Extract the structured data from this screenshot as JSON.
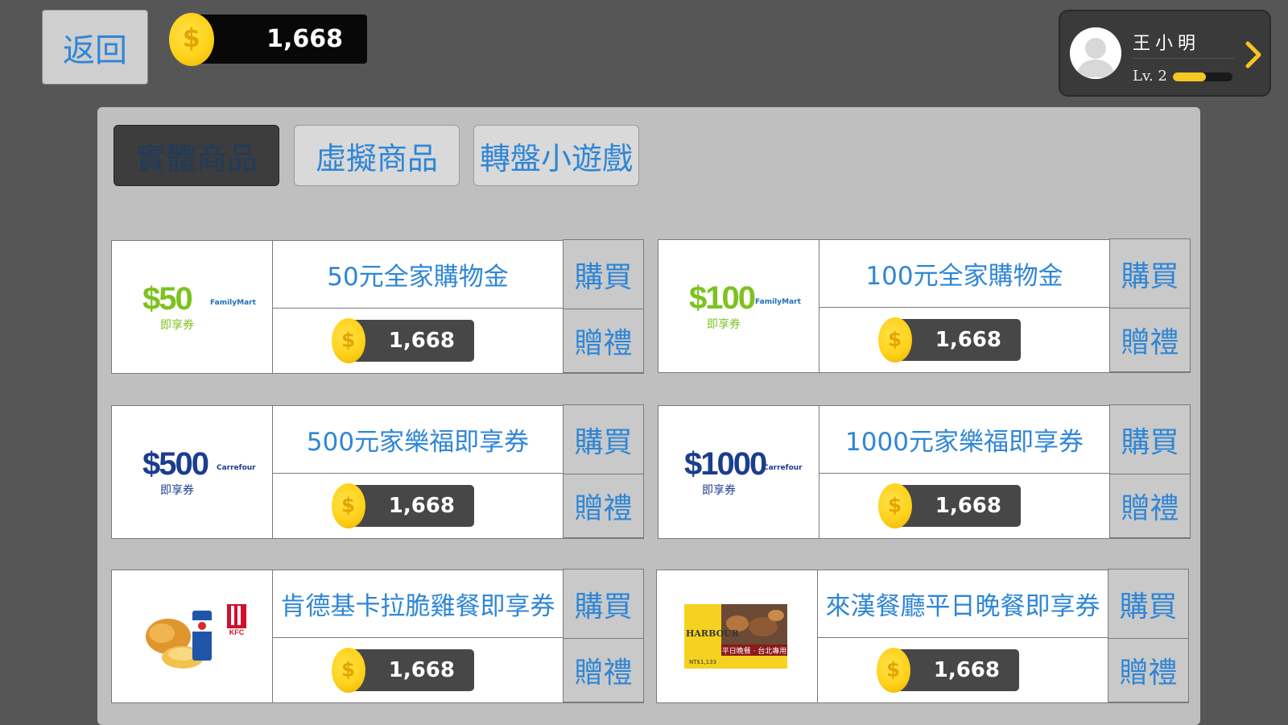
{
  "header": {
    "back_label": "返回",
    "coin_balance": "1,668"
  },
  "profile": {
    "name": "王小明",
    "level": "Lv. 2",
    "xp_progress": 0.55
  },
  "tabs": [
    {
      "label": "實體商品",
      "active": true
    },
    {
      "label": "虛擬商品",
      "active": false
    },
    {
      "label": "轉盤小遊戲",
      "active": false
    }
  ],
  "products": [
    {
      "title": "50元全家購物金",
      "price": "1,668",
      "buy": "購買",
      "gift": "贈禮",
      "image": {
        "amount": "$50",
        "sub": "即享券",
        "brand": "FamilyMart",
        "color": "#7cc21f"
      }
    },
    {
      "title": "100元全家購物金",
      "price": "1,668",
      "buy": "購買",
      "gift": "贈禮",
      "image": {
        "amount": "$100",
        "sub": "即享券",
        "brand": "FamilyMart",
        "color": "#7cc21f"
      }
    },
    {
      "title": "500元家樂福即享券",
      "price": "1,668",
      "buy": "購買",
      "gift": "贈禮",
      "image": {
        "amount": "$500",
        "sub": "即享券",
        "brand": "Carrefour",
        "color": "#1b3d8f"
      }
    },
    {
      "title": "1000元家樂福即享券",
      "price": "1,668",
      "buy": "購買",
      "gift": "贈禮",
      "image": {
        "amount": "$1000",
        "sub": "即享券",
        "brand": "Carrefour",
        "color": "#1b3d8f"
      }
    },
    {
      "title": "肯德基卡拉脆雞餐即享券",
      "price": "1,668",
      "buy": "購買",
      "gift": "贈禮",
      "image": {
        "brand": "KFC"
      }
    },
    {
      "title": "來漢餐廳平日晚餐即享券",
      "price": "1,668",
      "buy": "購買",
      "gift": "贈禮",
      "image": {
        "caption": "平日晚餐 · 台北專用",
        "price_text": "NT$1,133",
        "logo": "HARBOUR"
      }
    }
  ],
  "colors": {
    "background": "#575657",
    "panel": "#bfbfbf",
    "accent": "#2f86d6",
    "coin": "#ffd21a"
  }
}
